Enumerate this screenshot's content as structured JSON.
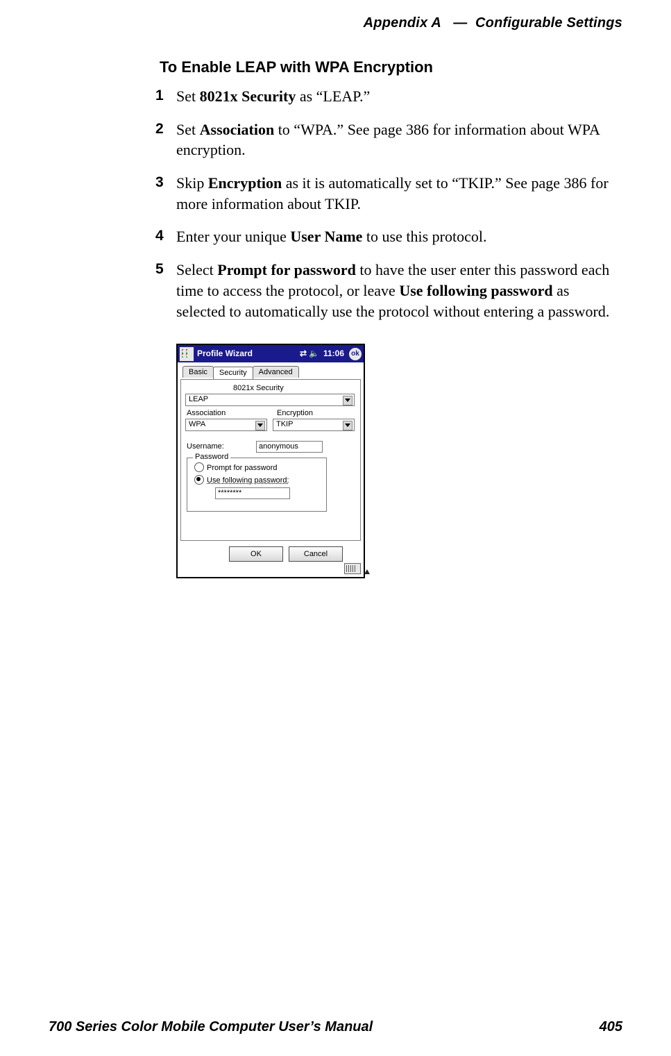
{
  "header": {
    "appendix": "Appendix A",
    "dash": "—",
    "section": "Configurable Settings"
  },
  "title": "To Enable LEAP with WPA Encryption",
  "steps": {
    "s1": {
      "num": "1",
      "pre": "Set ",
      "bold": "8021x Security",
      "post": " as “LEAP.”"
    },
    "s2": {
      "num": "2",
      "pre": "Set ",
      "bold": "Association",
      "post": " to “WPA.” See page 386 for information about WPA encryption."
    },
    "s3": {
      "num": "3",
      "pre": "Skip ",
      "bold": "Encryption",
      "post": " as it is automatically set to “TKIP.” See page 386 for more information about TKIP."
    },
    "s4": {
      "num": "4",
      "pre": "Enter your unique ",
      "bold": "User Name",
      "post": " to use this protocol."
    },
    "s5": {
      "num": "5",
      "pre": "Select ",
      "bold1": "Prompt for password",
      "mid": " to have the user enter this password each time to access the protocol, or leave ",
      "bold2": "Use following password",
      "post": " as selected to automatically use the protocol without entering a password."
    }
  },
  "screenshot": {
    "titlebar": {
      "title": "Profile Wizard",
      "time": "11:06",
      "ok": "ok"
    },
    "tabs": {
      "basic": "Basic",
      "security": "Security",
      "advanced": "Advanced"
    },
    "labels": {
      "sec": "8021x Security",
      "assoc": "Association",
      "enc": "Encryption",
      "user": "Username:",
      "pwdgroup": "Password",
      "r1": "Prompt for password",
      "r2": "Use following password:"
    },
    "values": {
      "sec": "LEAP",
      "assoc": "WPA",
      "enc": "TKIP",
      "user": "anonymous",
      "pwd": "********"
    },
    "buttons": {
      "ok": "OK",
      "cancel": "Cancel"
    }
  },
  "footer": {
    "manual": "700 Series Color Mobile Computer User’s Manual",
    "page": "405"
  }
}
